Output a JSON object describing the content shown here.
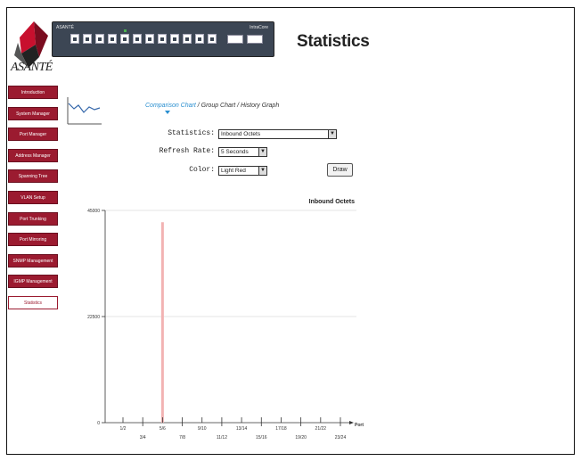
{
  "header": {
    "logo_text": "ASANTÉ",
    "title": "Statistics"
  },
  "sidebar": {
    "items": [
      {
        "label": "Introduction",
        "active": false
      },
      {
        "label": "System Manager",
        "active": false
      },
      {
        "label": "Port Manager",
        "active": false
      },
      {
        "label": "Address Manager",
        "active": false
      },
      {
        "label": "Spanning Tree",
        "active": false
      },
      {
        "label": "VLAN Setup",
        "active": false
      },
      {
        "label": "Port Trunking",
        "active": false
      },
      {
        "label": "Port Mirroring",
        "active": false
      },
      {
        "label": "SNMP Management",
        "active": false
      },
      {
        "label": "IGMP Management",
        "active": false
      },
      {
        "label": "Statistics",
        "active": true
      }
    ]
  },
  "tabs": [
    {
      "label": "Comparison Chart",
      "active": true
    },
    {
      "sep": " / "
    },
    {
      "label": "Group Chart",
      "active": false
    },
    {
      "sep": " / "
    },
    {
      "label": "History Graph",
      "active": false
    }
  ],
  "form": {
    "statistics_label": "Statistics:",
    "statistics_value": "Inbound Octets",
    "refresh_label": "Refresh Rate:",
    "refresh_value": "5 Seconds",
    "color_label": "Color:",
    "color_value": "Light Red",
    "draw_label": "Draw"
  },
  "colors": {
    "nav_bg": "#9b1b30",
    "accent": "#2a8fd0",
    "bar": "#f2b3b3"
  },
  "chart_data": {
    "type": "bar",
    "title": "Inbound Octets",
    "xlabel": "Port",
    "ylabel": "",
    "ylim": [
      0,
      45000
    ],
    "yticks": [
      "0",
      "22500",
      "45000"
    ],
    "categories": [
      "1-2",
      "3-4",
      "5-6",
      "7-8",
      "9-10",
      "11-12",
      "13-14",
      "15-16",
      "17-18",
      "19-20",
      "21-22",
      "23-24"
    ],
    "xtick_top": [
      "1/2",
      "5/6",
      "9/10",
      "13/14",
      "17/18",
      "21/22"
    ],
    "xtick_bottom": [
      "3/4",
      "7/8",
      "11/12",
      "15/16",
      "19/20",
      "23/24"
    ],
    "values": [
      0,
      0,
      42500,
      0,
      0,
      0,
      0,
      0,
      0,
      0,
      0,
      0
    ],
    "grid": true,
    "legend": "none"
  }
}
